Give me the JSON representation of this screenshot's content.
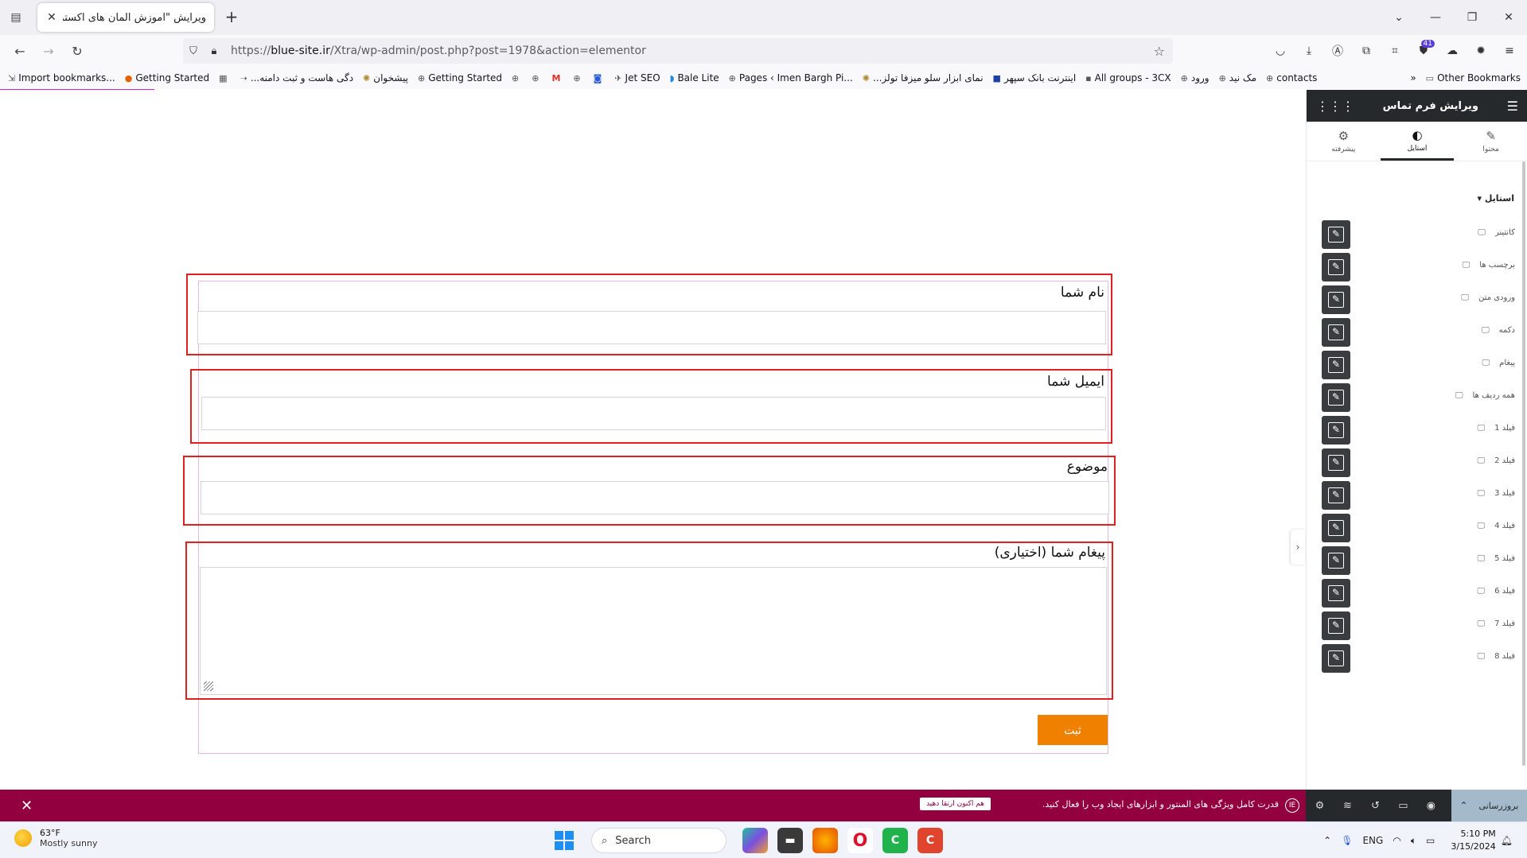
{
  "browser": {
    "tab_title": "ویرایش \"آموزش المان های اکسترا – ...",
    "url_prefix": "https://",
    "url_domain": "blue-site.ir",
    "url_path": "/Xtra/wp-admin/post.php?post=1978&action=elementor",
    "extension_badge": "41",
    "bookmarks": [
      {
        "icon": "⇲",
        "label": "Import bookmarks..."
      },
      {
        "icon": "●",
        "label": "Getting Started"
      },
      {
        "icon": "▦",
        "label": ""
      },
      {
        "icon": "➝",
        "label": "...دگی هاست و ثبت دامنه"
      },
      {
        "icon": "✺",
        "label": "پیشخوان"
      },
      {
        "icon": "⊕",
        "label": "Getting Started"
      },
      {
        "icon": "⊕",
        "label": ""
      },
      {
        "icon": "⊕",
        "label": ""
      },
      {
        "icon": "M",
        "label": ""
      },
      {
        "icon": "⊕",
        "label": ""
      },
      {
        "icon": "◙",
        "label": ""
      },
      {
        "icon": "✈",
        "label": "Jet SEO"
      },
      {
        "icon": "◗",
        "label": "Bale Lite"
      },
      {
        "icon": "⊕",
        "label": "Pages ‹ Imen Bargh Pi..."
      },
      {
        "icon": "✺",
        "label": "...نمای ابزار سلو میزفا تولز"
      },
      {
        "icon": "■",
        "label": "اینترنت بانک سپهر"
      },
      {
        "icon": "▪",
        "label": "All groups - 3CX"
      },
      {
        "icon": "⊕",
        "label": "ورود"
      },
      {
        "icon": "⊕",
        "label": "مک نید"
      },
      {
        "icon": "⊕",
        "label": "contacts"
      }
    ],
    "other_bookmarks": "Other Bookmarks"
  },
  "form": {
    "name_label": "نام شما",
    "email_label": "ایمیل شما",
    "subject_label": "موضوع",
    "message_label": "پیغام شما (اختیاری)",
    "submit_label": "ثبت"
  },
  "panel": {
    "title": "ویرایش فرم تماس",
    "tabs": [
      {
        "label": "محتوا",
        "icon": "✎"
      },
      {
        "label": "استایل",
        "icon": "◐"
      },
      {
        "label": "پیشرفته",
        "icon": "⚙"
      }
    ],
    "section_title": "استایل",
    "controls": [
      "کانتینر",
      "برچسب ها",
      "ورودی متن",
      "دکمه",
      "پیغام",
      "همه ردیف ها",
      "فیلد 1",
      "فیلد 2",
      "فیلد 3",
      "فیلد 4",
      "فیلد 5",
      "فیلد 6",
      "فیلد 7",
      "فیلد 8"
    ],
    "update_label": "بروزرسانی"
  },
  "notice": {
    "text": "قدرت کامل ویژگی های المنتور و ابزارهای ایجاد وب را فعال کنید.",
    "button": "هم اکنون ارتقا دهید"
  },
  "taskbar": {
    "temp": "63°F",
    "weather": "Mostly sunny",
    "search_placeholder": "Search",
    "lang": "ENG",
    "time": "5:10 PM",
    "date": "3/15/2024"
  }
}
